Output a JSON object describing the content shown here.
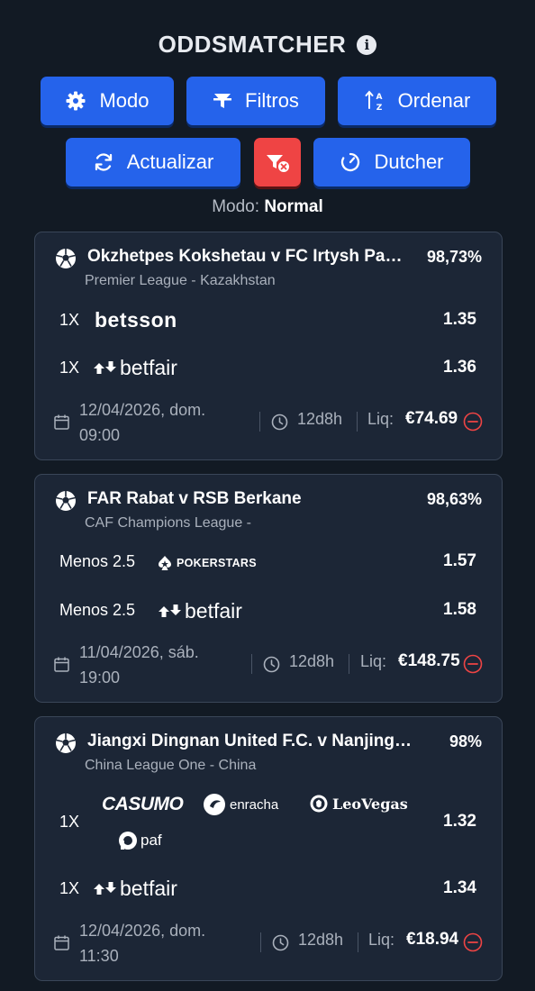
{
  "header": {
    "title": "ODDSMATCHER"
  },
  "toolbar": {
    "modo": "Modo",
    "filtros": "Filtros",
    "ordenar": "Ordenar",
    "actualizar": "Actualizar",
    "dutcher": "Dutcher"
  },
  "mode_line": {
    "label": "Modo:",
    "value": "Normal"
  },
  "colors": {
    "accent": "#2563eb",
    "danger": "#ef4444",
    "card": "#1c2636",
    "background": "#121a24"
  },
  "matches": [
    {
      "title": "Okzhetpes Kokshetau v FC Irtysh Pavlodar",
      "pct": "98,73%",
      "league": "Premier League - Kazakhstan",
      "bets": [
        {
          "label": "1X",
          "bookmakers": [
            "betsson"
          ],
          "odds": "1.35"
        },
        {
          "label": "1X",
          "bookmakers": [
            "betfair"
          ],
          "odds": "1.36"
        }
      ],
      "date_line1": "12/04/2026, dom.",
      "date_line2": "09:00",
      "duration": "12d8h",
      "liq_label": "Liq:",
      "liq": "€74.69"
    },
    {
      "title": "FAR Rabat v RSB Berkane",
      "pct": "98,63%",
      "league": "CAF Champions League -",
      "bets": [
        {
          "label": "Menos 2.5",
          "bookmakers": [
            "POKERSTARS"
          ],
          "odds": "1.57"
        },
        {
          "label": "Menos 2.5",
          "bookmakers": [
            "betfair"
          ],
          "odds": "1.58"
        }
      ],
      "date_line1": "11/04/2026, sáb.",
      "date_line2": "19:00",
      "duration": "12d8h",
      "liq_label": "Liq:",
      "liq": "€148.75"
    },
    {
      "title": "Jiangxi Dingnan United F.C. v Nanjing City",
      "pct": "98%",
      "league": "China League One - China",
      "bets": [
        {
          "label": "1X",
          "bookmakers": [
            "CASUMO",
            "enracha",
            "LeoVegas",
            "paf"
          ],
          "odds": "1.32"
        },
        {
          "label": "1X",
          "bookmakers": [
            "betfair"
          ],
          "odds": "1.34"
        }
      ],
      "date_line1": "12/04/2026, dom.",
      "date_line2": "11:30",
      "duration": "12d8h",
      "liq_label": "Liq:",
      "liq": "€18.94"
    }
  ]
}
